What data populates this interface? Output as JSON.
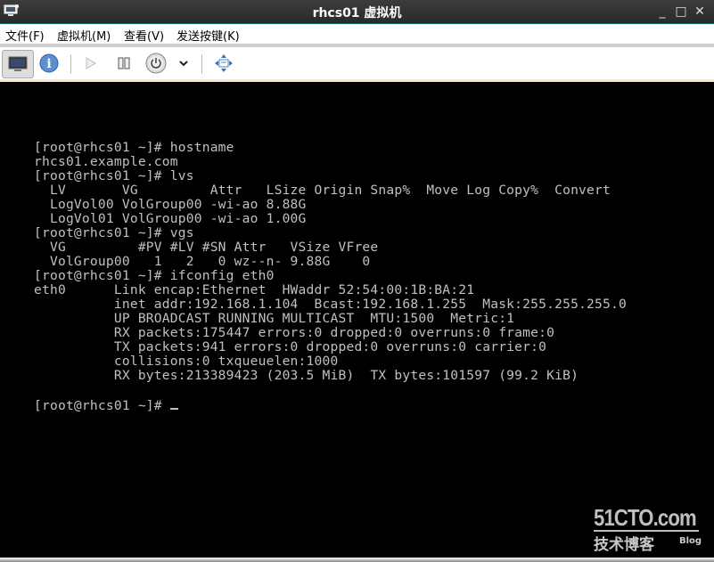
{
  "window": {
    "title": "rhcs01 虚拟机",
    "controls": {
      "minimize": "_",
      "maximize": "□",
      "close": "✕"
    }
  },
  "menubar": {
    "items": [
      {
        "label": "文件(F)"
      },
      {
        "label": "虚拟机(M)"
      },
      {
        "label": "查看(V)"
      },
      {
        "label": "发送按键(K)"
      }
    ]
  },
  "toolbar": {
    "buttons": [
      {
        "name": "console",
        "icon": "monitor-icon",
        "active": true
      },
      {
        "name": "details",
        "icon": "info-icon"
      },
      {
        "name": "run",
        "icon": "play-icon"
      },
      {
        "name": "pause",
        "icon": "pause-icon"
      },
      {
        "name": "shutdown",
        "icon": "power-icon"
      },
      {
        "name": "shutdown-menu",
        "icon": "chevron-down-icon"
      },
      {
        "name": "fullscreen",
        "icon": "fullscreen-arrows-icon"
      }
    ]
  },
  "terminal": {
    "lines": [
      "[root@rhcs01 ~]# hostname",
      "rhcs01.example.com",
      "[root@rhcs01 ~]# lvs",
      "  LV       VG         Attr   LSize Origin Snap%  Move Log Copy%  Convert",
      "  LogVol00 VolGroup00 -wi-ao 8.88G",
      "  LogVol01 VolGroup00 -wi-ao 1.00G",
      "[root@rhcs01 ~]# vgs",
      "  VG         #PV #LV #SN Attr   VSize VFree",
      "  VolGroup00   1   2   0 wz--n- 9.88G    0",
      "[root@rhcs01 ~]# ifconfig eth0",
      "eth0      Link encap:Ethernet  HWaddr 52:54:00:1B:BA:21",
      "          inet addr:192.168.1.104  Bcast:192.168.1.255  Mask:255.255.255.0",
      "          UP BROADCAST RUNNING MULTICAST  MTU:1500  Metric:1",
      "          RX packets:175447 errors:0 dropped:0 overruns:0 frame:0",
      "          TX packets:941 errors:0 dropped:0 overruns:0 carrier:0",
      "          collisions:0 txqueuelen:1000",
      "          RX bytes:213389423 (203.5 MiB)  TX bytes:101597 (99.2 KiB)",
      "",
      "[root@rhcs01 ~]# "
    ]
  },
  "watermark": {
    "top": "51CTO.com",
    "bottom": "技术博客",
    "blog": "Blog"
  }
}
